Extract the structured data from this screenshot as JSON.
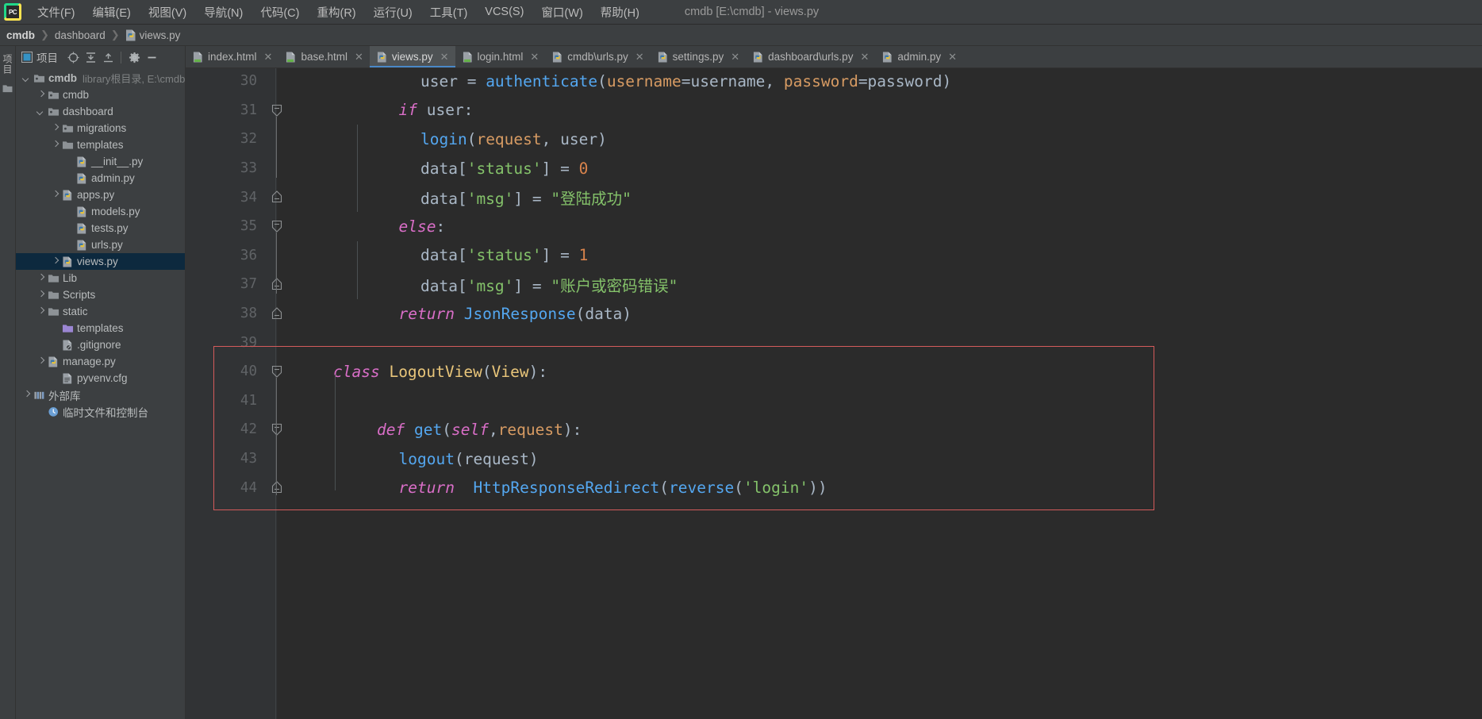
{
  "window": {
    "title": "cmdb [E:\\cmdb] - views.py",
    "logo_text": "PC"
  },
  "menubar": {
    "items": [
      {
        "label": "文件(F)",
        "name": "menu-file"
      },
      {
        "label": "编辑(E)",
        "name": "menu-edit"
      },
      {
        "label": "视图(V)",
        "name": "menu-view"
      },
      {
        "label": "导航(N)",
        "name": "menu-navigate"
      },
      {
        "label": "代码(C)",
        "name": "menu-code"
      },
      {
        "label": "重构(R)",
        "name": "menu-refactor"
      },
      {
        "label": "运行(U)",
        "name": "menu-run"
      },
      {
        "label": "工具(T)",
        "name": "menu-tools"
      },
      {
        "label": "VCS(S)",
        "name": "menu-vcs"
      },
      {
        "label": "窗口(W)",
        "name": "menu-window"
      },
      {
        "label": "帮助(H)",
        "name": "menu-help"
      }
    ]
  },
  "breadcrumb": {
    "items": [
      {
        "label": "cmdb",
        "bold": true,
        "icon": null
      },
      {
        "label": "dashboard",
        "bold": false,
        "icon": null
      },
      {
        "label": "views.py",
        "bold": false,
        "icon": "python-file-icon"
      }
    ],
    "separator": "❯"
  },
  "left_strip": {
    "tab_label": "项目",
    "icon": "folder-icon"
  },
  "project_panel": {
    "title": "项目",
    "toolbar": [
      {
        "name": "project-view-selector-icon",
        "label": "project-scope"
      },
      {
        "name": "locate-target-icon",
        "label": "scroll-from-source"
      },
      {
        "name": "expand-all-icon",
        "label": "expand-all"
      },
      {
        "name": "collapse-all-icon",
        "label": "collapse-all"
      },
      {
        "name": "gear-icon",
        "label": "settings"
      },
      {
        "name": "minimize-icon",
        "label": "hide"
      }
    ],
    "tree": [
      {
        "label": "cmdb",
        "meta": "library根目录, E:\\cmdb",
        "indent": 0,
        "arrow": "open",
        "icon": "folder-module-icon",
        "bold": true,
        "selected": false
      },
      {
        "label": "cmdb",
        "meta": "",
        "indent": 1,
        "arrow": "closed",
        "icon": "folder-source-icon",
        "bold": false,
        "selected": false
      },
      {
        "label": "dashboard",
        "meta": "",
        "indent": 1,
        "arrow": "open",
        "icon": "folder-source-icon",
        "bold": false,
        "selected": false
      },
      {
        "label": "migrations",
        "meta": "",
        "indent": 2,
        "arrow": "closed",
        "icon": "folder-source-icon",
        "bold": false,
        "selected": false
      },
      {
        "label": "templates",
        "meta": "",
        "indent": 2,
        "arrow": "closed",
        "icon": "folder-icon",
        "bold": false,
        "selected": false
      },
      {
        "label": "__init__.py",
        "meta": "",
        "indent": 3,
        "arrow": "none",
        "icon": "python-file-icon",
        "bold": false,
        "selected": false
      },
      {
        "label": "admin.py",
        "meta": "",
        "indent": 3,
        "arrow": "none",
        "icon": "python-file-icon",
        "bold": false,
        "selected": false
      },
      {
        "label": "apps.py",
        "meta": "",
        "indent": 2,
        "arrow": "closed",
        "icon": "python-file-icon",
        "bold": false,
        "selected": false
      },
      {
        "label": "models.py",
        "meta": "",
        "indent": 3,
        "arrow": "none",
        "icon": "python-file-icon",
        "bold": false,
        "selected": false
      },
      {
        "label": "tests.py",
        "meta": "",
        "indent": 3,
        "arrow": "none",
        "icon": "python-file-icon",
        "bold": false,
        "selected": false
      },
      {
        "label": "urls.py",
        "meta": "",
        "indent": 3,
        "arrow": "none",
        "icon": "python-file-icon",
        "bold": false,
        "selected": false
      },
      {
        "label": "views.py",
        "meta": "",
        "indent": 2,
        "arrow": "closed",
        "icon": "python-file-icon",
        "bold": false,
        "selected": true
      },
      {
        "label": "Lib",
        "meta": "",
        "indent": 1,
        "arrow": "closed",
        "icon": "folder-icon",
        "bold": false,
        "selected": false
      },
      {
        "label": "Scripts",
        "meta": "",
        "indent": 1,
        "arrow": "closed",
        "icon": "folder-icon",
        "bold": false,
        "selected": false
      },
      {
        "label": "static",
        "meta": "",
        "indent": 1,
        "arrow": "closed",
        "icon": "folder-icon",
        "bold": false,
        "selected": false
      },
      {
        "label": "templates",
        "meta": "",
        "indent": 2,
        "arrow": "none",
        "icon": "folder-template-icon",
        "bold": false,
        "selected": false
      },
      {
        "label": ".gitignore",
        "meta": "",
        "indent": 2,
        "arrow": "none",
        "icon": "gitignore-file-icon",
        "bold": false,
        "selected": false
      },
      {
        "label": "manage.py",
        "meta": "",
        "indent": 1,
        "arrow": "closed",
        "icon": "python-file-icon",
        "bold": false,
        "selected": false
      },
      {
        "label": "pyvenv.cfg",
        "meta": "",
        "indent": 2,
        "arrow": "none",
        "icon": "config-file-icon",
        "bold": false,
        "selected": false
      },
      {
        "label": "外部库",
        "meta": "",
        "indent": 0,
        "arrow": "closed",
        "icon": "external-libraries-icon",
        "bold": false,
        "selected": false
      },
      {
        "label": "临时文件和控制台",
        "meta": "",
        "indent": 1,
        "arrow": "none",
        "icon": "scratches-icon",
        "bold": false,
        "selected": false
      }
    ]
  },
  "editor": {
    "tabs": [
      {
        "label": "index.html",
        "icon": "html-file-icon",
        "active": false,
        "close": "✕"
      },
      {
        "label": "base.html",
        "icon": "html-file-icon",
        "active": false,
        "close": "✕"
      },
      {
        "label": "views.py",
        "icon": "python-file-icon",
        "active": true,
        "close": "✕"
      },
      {
        "label": "login.html",
        "icon": "html-file-icon",
        "active": false,
        "close": "✕"
      },
      {
        "label": "cmdb\\urls.py",
        "icon": "python-file-icon",
        "active": false,
        "close": "✕"
      },
      {
        "label": "settings.py",
        "icon": "python-file-icon",
        "active": false,
        "close": "✕"
      },
      {
        "label": "dashboard\\urls.py",
        "icon": "python-file-icon",
        "active": false,
        "close": "✕"
      },
      {
        "label": "admin.py",
        "icon": "python-file-icon",
        "active": false,
        "close": "✕"
      }
    ],
    "first_line_number": 30,
    "annotation": {
      "color": "#d45b5b",
      "from_line": 40,
      "to_line": 44
    },
    "lines": [
      {
        "num": 30,
        "fold": "none",
        "indent_guides": [],
        "tokens": [
          {
            "t": "user ",
            "c": "plain"
          },
          {
            "t": "= ",
            "c": "plain"
          },
          {
            "t": "authenticate",
            "c": "fn"
          },
          {
            "t": "(",
            "c": "plain"
          },
          {
            "t": "username",
            "c": "param"
          },
          {
            "t": "=username, ",
            "c": "plain"
          },
          {
            "t": "password",
            "c": "param"
          },
          {
            "t": "=password)",
            "c": "plain"
          }
        ],
        "indent": 4
      },
      {
        "num": 31,
        "fold": "collapse-down",
        "indent_guides": [],
        "tokens": [
          {
            "t": "if",
            "c": "kwi"
          },
          {
            "t": " user:",
            "c": "plain"
          }
        ],
        "indent": 3
      },
      {
        "num": 32,
        "fold": "none",
        "indent_guides": [
          1
        ],
        "tokens": [
          {
            "t": "login",
            "c": "fn"
          },
          {
            "t": "(",
            "c": "plain"
          },
          {
            "t": "request",
            "c": "param"
          },
          {
            "t": ", user)",
            "c": "plain"
          }
        ],
        "indent": 4
      },
      {
        "num": 33,
        "fold": "none",
        "indent_guides": [
          1
        ],
        "tokens": [
          {
            "t": "data[",
            "c": "plain"
          },
          {
            "t": "'status'",
            "c": "str"
          },
          {
            "t": "] = ",
            "c": "plain"
          },
          {
            "t": "0",
            "c": "num"
          }
        ],
        "indent": 4
      },
      {
        "num": 34,
        "fold": "collapse-up",
        "indent_guides": [
          1
        ],
        "tokens": [
          {
            "t": "data[",
            "c": "plain"
          },
          {
            "t": "'msg'",
            "c": "str"
          },
          {
            "t": "] = ",
            "c": "plain"
          },
          {
            "t": "\"登陆成功\"",
            "c": "str"
          }
        ],
        "indent": 4
      },
      {
        "num": 35,
        "fold": "collapse-down",
        "indent_guides": [],
        "tokens": [
          {
            "t": "else",
            "c": "kwi"
          },
          {
            "t": ":",
            "c": "plain"
          }
        ],
        "indent": 3
      },
      {
        "num": 36,
        "fold": "none",
        "indent_guides": [
          1
        ],
        "tokens": [
          {
            "t": "data[",
            "c": "plain"
          },
          {
            "t": "'status'",
            "c": "str"
          },
          {
            "t": "] = ",
            "c": "plain"
          },
          {
            "t": "1",
            "c": "num"
          }
        ],
        "indent": 4
      },
      {
        "num": 37,
        "fold": "collapse-up",
        "indent_guides": [
          1
        ],
        "tokens": [
          {
            "t": "data[",
            "c": "plain"
          },
          {
            "t": "'msg'",
            "c": "str"
          },
          {
            "t": "] = ",
            "c": "plain"
          },
          {
            "t": "\"账户或密码错误\"",
            "c": "str"
          }
        ],
        "indent": 4
      },
      {
        "num": 38,
        "fold": "collapse-up",
        "indent_guides": [],
        "tokens": [
          {
            "t": "return",
            "c": "kwi"
          },
          {
            "t": " ",
            "c": "plain"
          },
          {
            "t": "JsonResponse",
            "c": "fn"
          },
          {
            "t": "(data)",
            "c": "plain"
          }
        ],
        "indent": 3
      },
      {
        "num": 39,
        "fold": "none",
        "indent_guides": [],
        "tokens": [],
        "indent": 0
      },
      {
        "num": 40,
        "fold": "expand",
        "indent_guides": [],
        "tokens": [
          {
            "t": "class",
            "c": "kwi"
          },
          {
            "t": " ",
            "c": "plain"
          },
          {
            "t": "LogoutView",
            "c": "cls"
          },
          {
            "t": "(",
            "c": "plain"
          },
          {
            "t": "View",
            "c": "cls"
          },
          {
            "t": "):",
            "c": "plain"
          }
        ],
        "indent": 0
      },
      {
        "num": 41,
        "fold": "none",
        "indent_guides": [],
        "tokens": [],
        "indent": 0
      },
      {
        "num": 42,
        "fold": "expand",
        "indent_guides": [],
        "tokens": [
          {
            "t": "def",
            "c": "kwi"
          },
          {
            "t": " ",
            "c": "plain"
          },
          {
            "t": "get",
            "c": "fn"
          },
          {
            "t": "(",
            "c": "plain"
          },
          {
            "t": "self",
            "c": "selfkw"
          },
          {
            "t": ",",
            "c": "plain"
          },
          {
            "t": "request",
            "c": "param"
          },
          {
            "t": "):",
            "c": "plain"
          }
        ],
        "indent": 2
      },
      {
        "num": 43,
        "fold": "none",
        "indent_guides": [],
        "tokens": [
          {
            "t": "logout",
            "c": "fn"
          },
          {
            "t": "(",
            "c": "plain"
          },
          {
            "t": "request",
            "c": "plain"
          },
          {
            "t": ")",
            "c": "plain"
          }
        ],
        "indent": 3
      },
      {
        "num": 44,
        "fold": "collapse-up",
        "indent_guides": [],
        "tokens": [
          {
            "t": "return",
            "c": "kwi"
          },
          {
            "t": "  ",
            "c": "plain"
          },
          {
            "t": "HttpResponseRedirect",
            "c": "fn"
          },
          {
            "t": "(",
            "c": "plain"
          },
          {
            "t": "reverse",
            "c": "fn"
          },
          {
            "t": "(",
            "c": "plain"
          },
          {
            "t": "'login'",
            "c": "str"
          },
          {
            "t": "))",
            "c": "plain"
          }
        ],
        "indent": 3
      }
    ]
  },
  "colors": {
    "ui_bg": "#3c3f41",
    "editor_bg": "#2b2b2b",
    "gutter_bg": "#313335",
    "selection": "#0d293e",
    "tab_active": "#4e5254",
    "tab_underline": "#4a88c7",
    "annotation_red": "#d45b5b",
    "string_green": "#84c26a",
    "keyword_magenta": "#d96ec7",
    "function_blue": "#54a7f0",
    "class_gold": "#e8c57a",
    "param_orange": "#d79b63"
  }
}
